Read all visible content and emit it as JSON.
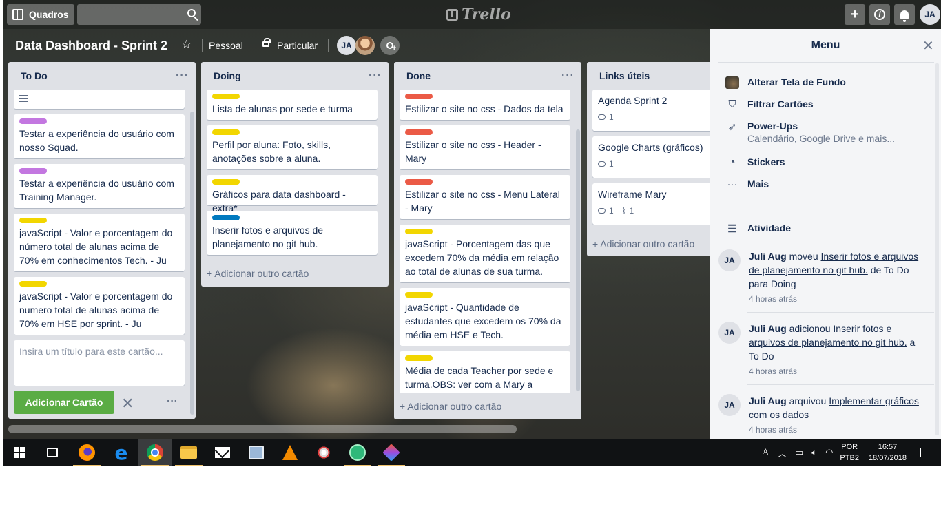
{
  "header": {
    "boards_label": "Quadros",
    "logo_text": "Trello",
    "user_initials": "JA"
  },
  "board": {
    "title": "Data Dashboard - Sprint 2",
    "team": "Pessoal",
    "privacy": "Particular",
    "member_initials": "JA"
  },
  "lists": {
    "todo": {
      "title": "To Do",
      "cards": [
        "Testar a experiência do usuário com nosso Squad.",
        "Testar a experiência do usuário com Training Manager.",
        "javaScript - Valor e porcentagem do número total de alunas acima de 70% em conhecimentos Tech. - Ju",
        "javaScript - Valor e porcentagem do numero total de alunas acima de 70% em HSE por sprint. - Ju"
      ],
      "composer_placeholder": "Insira um título para este cartão...",
      "submit_label": "Adicionar Cartão",
      "close_label": "✕",
      "more_label": "···"
    },
    "doing": {
      "title": "Doing",
      "cards": [
        "Lista de alunas por sede e turma",
        "Perfil por aluna: Foto, skills, anotações sobre a aluna.",
        "Gráficos para data dashboard - extra*",
        "Inserir fotos e arquivos de planejamento no git hub."
      ],
      "add_label": "+ Adicionar outro cartão"
    },
    "done": {
      "title": "Done",
      "cards": [
        "Estilizar o site no css - Dados da tela",
        "Estilizar o site no css - Header - Mary",
        "Estilizar o site no css - Menu Lateral - Mary",
        "javaScript - Porcentagem das que excedem 70% da média em relação ao total de alunas de sua turma.",
        "javaScript - Quantidade de estudantes que excedem os 70% da média em HSE e Tech.",
        "Média de cada Teacher por sede e turma.OBS: ver com a Mary a"
      ],
      "add_label": "+ Adicionar outro cartão"
    },
    "links": {
      "title": "Links úteis",
      "cards": [
        {
          "title": "Agenda Sprint 2",
          "comments": "1"
        },
        {
          "title": "Google Charts (gráficos)",
          "comments": "1"
        },
        {
          "title": "Wireframe Mary",
          "comments": "1",
          "attachments": "1"
        }
      ],
      "add_label": "+ Adicionar outro cartão"
    },
    "list_menu": "···"
  },
  "labels": {
    "purple": "#c377e0",
    "yellow": "#f2d600",
    "red": "#eb5a46",
    "blue": "#0079bf"
  },
  "menu": {
    "title": "Menu",
    "close": "✕",
    "items": [
      {
        "label": "Alterar Tela de Fundo",
        "icon": "background-thumbnail"
      },
      {
        "label": "Filtrar Cartões",
        "icon": "filter-icon"
      },
      {
        "label": "Power-Ups",
        "sub": "Calendário, Google Drive e mais...",
        "icon": "rocket-icon"
      },
      {
        "label": "Stickers",
        "icon": "sticker-icon"
      },
      {
        "label": "Mais",
        "icon": "more-icon"
      }
    ],
    "activity_title": "Atividade",
    "activity": [
      {
        "initials": "JA",
        "user": "Juli Aug",
        "verb": "moveu",
        "link": "Inserir fotos e arquivos de planejamento no git hub.",
        "rest": "de To Do para Doing",
        "time": "4 horas atrás"
      },
      {
        "initials": "JA",
        "user": "Juli Aug",
        "verb": "adicionou",
        "link": "Inserir fotos e arquivos de planejamento no git hub.",
        "rest": "a To Do",
        "time": "4 horas atrás"
      },
      {
        "initials": "JA",
        "user": "Juli Aug",
        "verb": "arquivou",
        "link": "Implementar gráficos com os dados",
        "rest": "",
        "time": "4 horas atrás"
      }
    ]
  },
  "taskbar": {
    "lang_top": "POR",
    "lang_bottom": "PTB2",
    "time": "16:57",
    "date": "18/07/2018"
  }
}
